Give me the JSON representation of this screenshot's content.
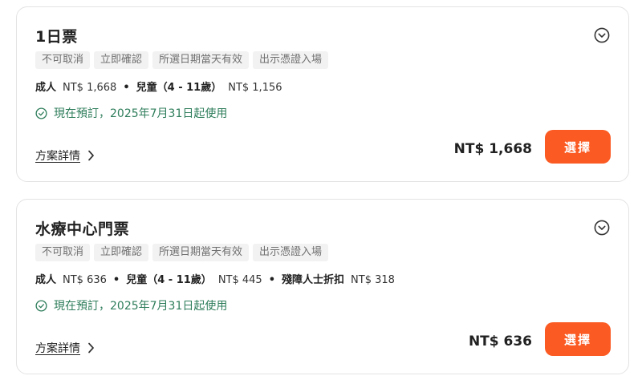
{
  "colors": {
    "accent": "#fb5a22",
    "status_green": "#2e7d5b",
    "tag_bg": "#f2f2f2"
  },
  "packages": [
    {
      "title": "1日票",
      "tags": [
        "不可取消",
        "立即確認",
        "所選日期當天有效",
        "出示憑證入場"
      ],
      "prices": [
        {
          "label": "成人",
          "value": "NT$ 1,668"
        },
        {
          "label": "兒童（4 - 11歲）",
          "value": "NT$ 1,156"
        }
      ],
      "status": "現在預訂，2025年7月31日起使用",
      "details_label": "方案詳情",
      "total": "NT$ 1,668",
      "select_label": "選擇"
    },
    {
      "title": "水療中心門票",
      "tags": [
        "不可取消",
        "立即確認",
        "所選日期當天有效",
        "出示憑證入場"
      ],
      "prices": [
        {
          "label": "成人",
          "value": "NT$ 636"
        },
        {
          "label": "兒童（4 - 11歲）",
          "value": "NT$ 445"
        },
        {
          "label": "殘障人士折扣",
          "value": "NT$ 318"
        }
      ],
      "status": "現在預訂，2025年7月31日起使用",
      "details_label": "方案詳情",
      "total": "NT$ 636",
      "select_label": "選擇"
    }
  ]
}
